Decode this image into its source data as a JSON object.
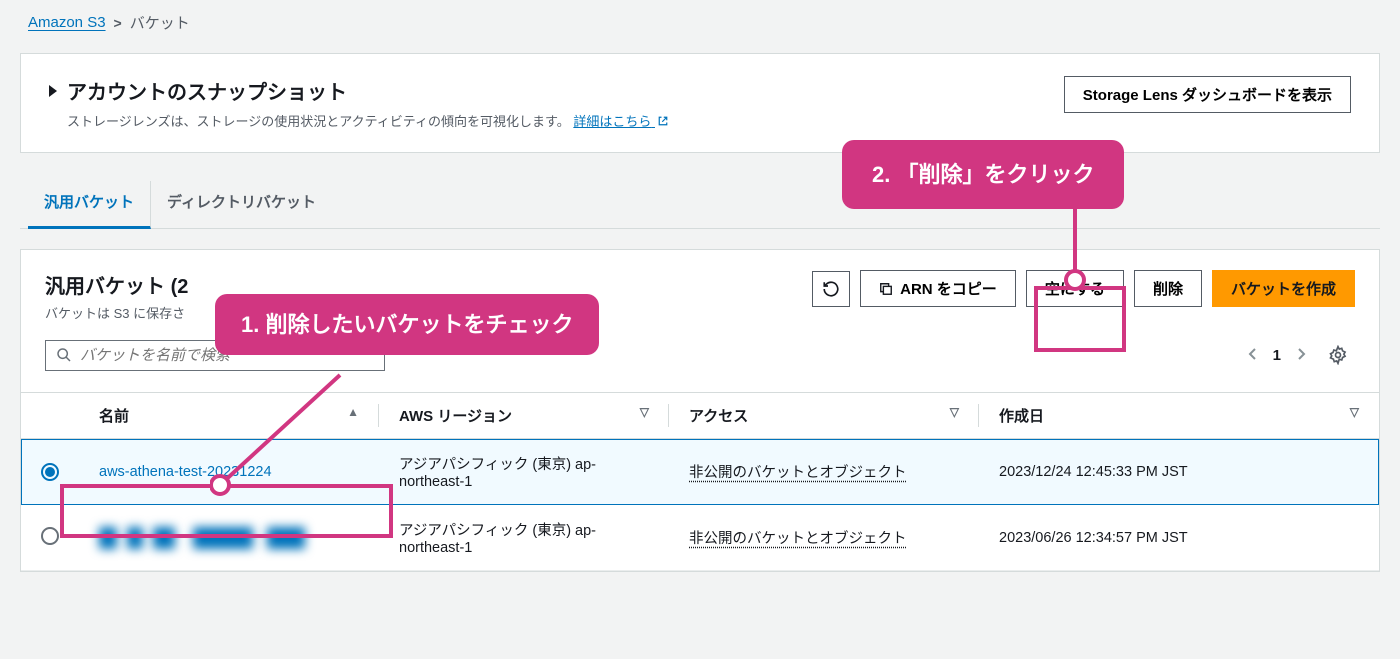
{
  "breadcrumb": {
    "root": "Amazon S3",
    "current": "バケット"
  },
  "snapshot": {
    "title": "アカウントのスナップショット",
    "desc_prefix": "ストレージレンズは、ストレージの使用状況とアクティビティの傾向を可視化します。",
    "desc_link": "詳細はこちら",
    "button": "Storage Lens ダッシュボードを表示"
  },
  "tabs": [
    {
      "label": "汎用バケット",
      "active": true
    },
    {
      "label": "ディレクトリバケット",
      "active": false
    }
  ],
  "panel": {
    "title_prefix": "汎用バケット",
    "title_count_visible": "(2",
    "subtitle_prefix": "バケットは S3 に保存さ"
  },
  "actions": {
    "copy_arn": "ARN をコピー",
    "empty": "空にする",
    "delete": "削除",
    "create": "バケットを作成"
  },
  "search": {
    "placeholder": "バケットを名前で検索"
  },
  "pager": {
    "page": "1"
  },
  "columns": {
    "name": "名前",
    "region": "AWS リージョン",
    "access": "アクセス",
    "created": "作成日"
  },
  "rows": [
    {
      "selected": true,
      "name": "aws-athena-test-20231224",
      "region": "アジアパシフィック (東京) ap-northeast-1",
      "access": "非公開のバケットとオブジェクト",
      "created": "2023/12/24 12:45:33 PM JST"
    },
    {
      "selected": false,
      "name": "",
      "redacted": true,
      "region": "アジアパシフィック (東京) ap-northeast-1",
      "access": "非公開のバケットとオブジェクト",
      "created": "2023/06/26 12:34:57 PM JST"
    }
  ],
  "annotations": {
    "a1": "1. 削除したいバケットをチェック",
    "a2": "2. 「削除」をクリック"
  }
}
